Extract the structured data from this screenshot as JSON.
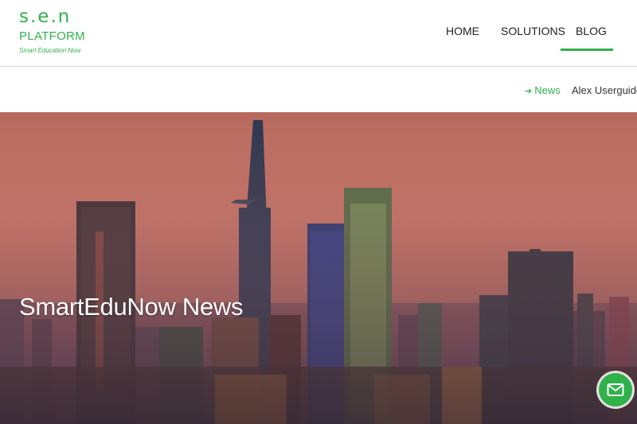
{
  "logo": {
    "mark": "s.e.n",
    "name": "PLATFORM",
    "tagline": "Smart Education Now"
  },
  "nav": {
    "items": [
      {
        "label": "HOME",
        "active": false
      },
      {
        "label": "SOLUTIONS",
        "active": false
      },
      {
        "label": "BLOG",
        "active": true
      }
    ]
  },
  "breadcrumb": {
    "parent": "News",
    "current": "Alex Userguide"
  },
  "hero": {
    "title": "SmartEduNow News"
  },
  "contact": {
    "icon": "mail-icon"
  },
  "colors": {
    "accent": "#2fb24a",
    "text": "#222222"
  }
}
